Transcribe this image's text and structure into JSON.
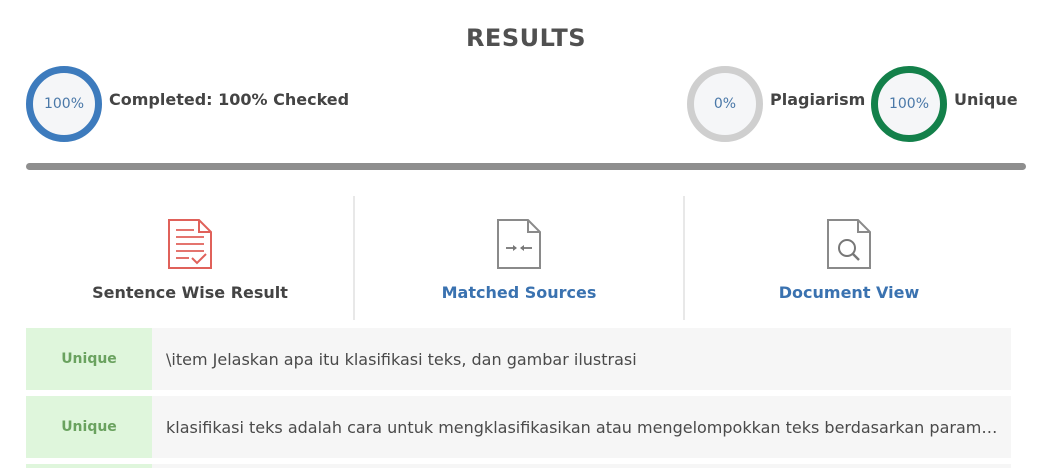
{
  "header": {
    "title": "RESULTS"
  },
  "summary": {
    "completed": {
      "ring_value": "100%",
      "label": "Completed: 100% Checked",
      "color": "#3d7bbd"
    },
    "plagiarism": {
      "ring_value": "0%",
      "label": "Plagiarism",
      "color": "#cfcfcf"
    },
    "unique": {
      "ring_value": "100%",
      "label": "Unique",
      "color": "#13804a"
    },
    "progress_fraction": 1.0
  },
  "tabs": [
    {
      "label": "Sentence Wise Result",
      "icon": "document-checked-icon",
      "active": true
    },
    {
      "label": "Matched Sources",
      "icon": "document-compare-icon",
      "active": false
    },
    {
      "label": "Document View",
      "icon": "document-search-icon",
      "active": false
    }
  ],
  "results": [
    {
      "status": "Unique",
      "text": "\\item Jelaskan apa itu klasifikasi teks, dan gambar ilustrasi"
    },
    {
      "status": "Unique",
      "text": "klasifikasi teks adalah cara untuk mengklasifikasikan atau mengelompokkan teks berdasarkan paramet..."
    }
  ]
}
